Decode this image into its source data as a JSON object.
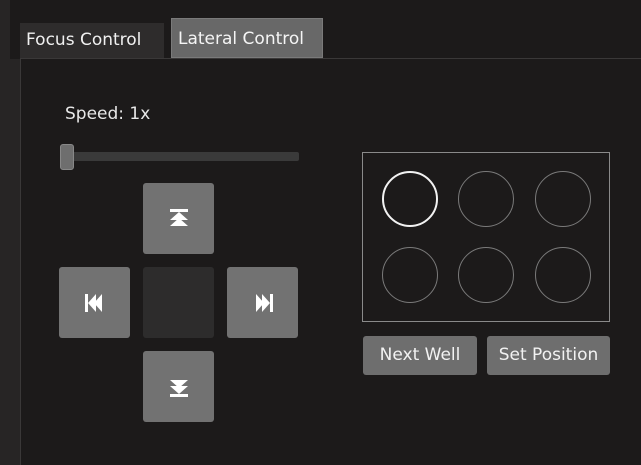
{
  "tabs": [
    {
      "label": "Focus Control",
      "active": false
    },
    {
      "label": "Lateral Control",
      "active": true
    }
  ],
  "speed": {
    "label": "Speed: 1x",
    "slider_value": 0
  },
  "direction_pad": {
    "up_icon": "skip-to-top-icon",
    "left_icon": "skip-back-icon",
    "right_icon": "skip-forward-icon",
    "down_icon": "skip-to-bottom-icon"
  },
  "well_plate": {
    "rows": 2,
    "cols": 3,
    "wells": [
      {
        "id": "A1",
        "selected": true
      },
      {
        "id": "A2",
        "selected": false
      },
      {
        "id": "A3",
        "selected": false
      },
      {
        "id": "B1",
        "selected": false
      },
      {
        "id": "B2",
        "selected": false
      },
      {
        "id": "B3",
        "selected": false
      }
    ]
  },
  "buttons": {
    "next_well": "Next Well",
    "set_position": "Set Position"
  },
  "colors": {
    "background": "#1c1a1a",
    "button": "#727272",
    "selected_well": "#f2f2f2",
    "well_outline": "#7a7a7a"
  }
}
